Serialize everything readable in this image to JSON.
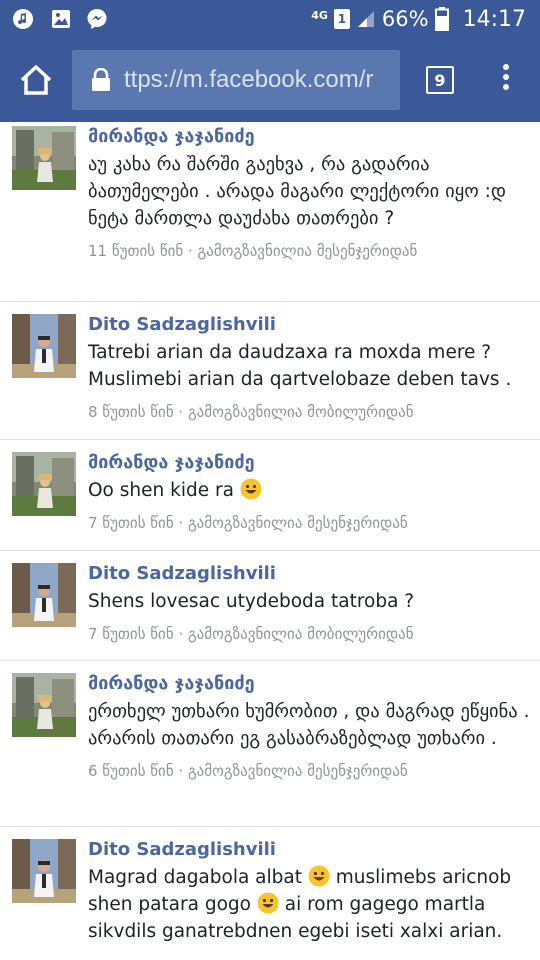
{
  "status_bar": {
    "network": "4G",
    "sim": "1",
    "battery": "66%",
    "time": "14:17",
    "icons": [
      "music-icon",
      "image-icon",
      "messenger-icon",
      "signal-icon",
      "battery-icon"
    ]
  },
  "browser": {
    "url": "ttps://m.facebook.com/r",
    "tab_count": "9",
    "icons": [
      "home-icon",
      "lock-icon",
      "tabs-icon",
      "overflow-menu-icon"
    ]
  },
  "comments": [
    {
      "author": "მირანდა ჯაჯანიძე",
      "text_parts": [
        "აუ კახა რა შარში გაეხვა , რა გადარია ბათუმელები . არადა მაგარი ლექტორი იყო :დ ნეტა მართლა დაუძახა თათრები ?"
      ],
      "meta": "11 წუთის წინ · გამოგზავნილია მესენჯერიდან",
      "avatar": "miranda"
    },
    {
      "author": "Dito Sadzaglishvili",
      "text_parts": [
        "Tatrebi arian da daudzaxa ra moxda mere ? Muslimebi arian da qartvelobaze deben tavs ."
      ],
      "meta": "8 წუთის წინ · გამოგზავნილია მობილურიდან",
      "avatar": "dito"
    },
    {
      "author": "მირანდა ჯაჯანიძე",
      "text_parts": [
        "Oo shen kide ra"
      ],
      "meta": "7 წუთის წინ · გამოგზავნილია მესენჯერიდან",
      "avatar": "miranda"
    },
    {
      "author": "Dito Sadzaglishvili",
      "text_parts": [
        "Shens lovesac utydeboda tatroba ?"
      ],
      "meta": "7 წუთის წინ · გამოგზავნილია მობილურიდან",
      "avatar": "dito"
    },
    {
      "author": "მირანდა ჯაჯანიძე",
      "text_parts": [
        "ერთხელ უთხარი ხუმრობით , და მაგრად ეწყინა . არარის თათარი ეგ გასაბრაზებლად უთხარი ."
      ],
      "meta": "6 წუთის წინ · გამოგზავნილია მესენჯერიდან",
      "avatar": "miranda"
    },
    {
      "author": "Dito Sadzaglishvili",
      "text_parts": [
        "Magrad dagabola albat",
        "muslimebs aricnob shen patara gogo",
        "ai rom gagego martla sikvdils ganatrebdnen egebi iseti xalxi arian."
      ],
      "meta": "",
      "avatar": "dito"
    }
  ]
}
